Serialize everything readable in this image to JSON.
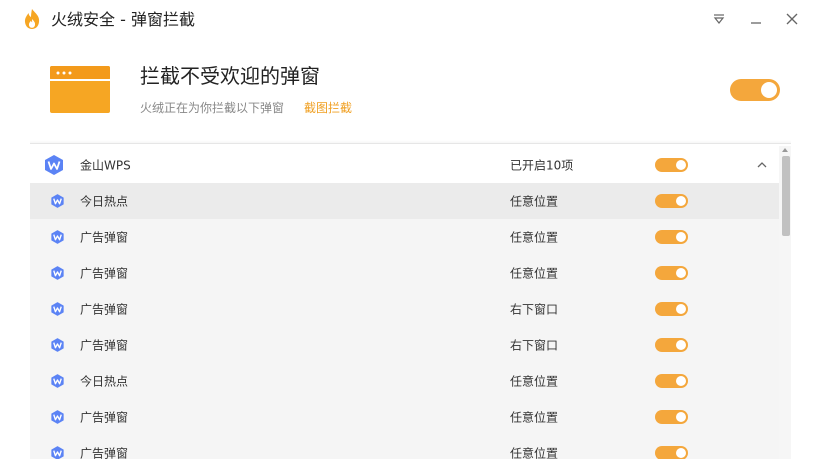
{
  "window": {
    "title": "火绒安全 - 弹窗拦截",
    "icons": {
      "logo": "huorong-flame-logo",
      "menu": "dropdown-menu-icon",
      "minimize": "minimize-icon",
      "close": "close-icon"
    }
  },
  "header": {
    "title": "拦截不受欢迎的弹窗",
    "description": "火绒正在为你拦截以下弹窗",
    "link": "截图拦截",
    "enabled": true,
    "icon": "popup-window-illustration"
  },
  "colors": {
    "accent": "#f4a73c",
    "toggle_knob": "#ffffff",
    "link": "#f0a023",
    "wps_icon": "#5b83f5"
  },
  "list": {
    "group": {
      "name": "金山WPS",
      "status": "已开启10项",
      "enabled": true,
      "icon": "wps-icon",
      "expand_icon": "chevron-up-icon"
    },
    "items": [
      {
        "name": "今日热点",
        "position": "任意位置",
        "enabled": true
      },
      {
        "name": "广告弹窗",
        "position": "任意位置",
        "enabled": true
      },
      {
        "name": "广告弹窗",
        "position": "任意位置",
        "enabled": true
      },
      {
        "name": "广告弹窗",
        "position": "右下窗口",
        "enabled": true
      },
      {
        "name": "广告弹窗",
        "position": "右下窗口",
        "enabled": true
      },
      {
        "name": "今日热点",
        "position": "任意位置",
        "enabled": true
      },
      {
        "name": "广告弹窗",
        "position": "任意位置",
        "enabled": true
      },
      {
        "name": "广告弹窗",
        "position": "任意位置",
        "enabled": true
      }
    ]
  }
}
